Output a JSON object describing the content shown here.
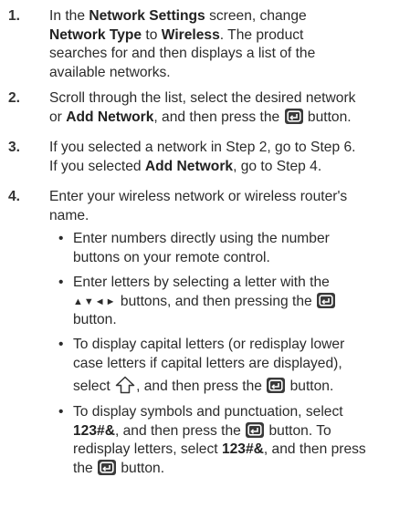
{
  "steps": [
    {
      "num": "1.",
      "parts": {
        "a": "In the ",
        "b": "Network Settings",
        "c": " screen, change",
        "d": "Network Type",
        "e": " to ",
        "f": "Wireless",
        "g": ". The product",
        "h": "searches for and then displays a list of the",
        "i": "available networks."
      }
    },
    {
      "num": "2.",
      "parts": {
        "a": "Scroll through the list, select the desired network",
        "b": "or ",
        "c": "Add Network",
        "d": ", and then press the",
        "e": "button."
      }
    },
    {
      "num": "3.",
      "parts": {
        "a": "If you selected a network in Step 2, go to Step 6.",
        "b": "If you selected ",
        "c": "Add Network",
        "d": ", go to Step 4."
      }
    },
    {
      "num": "4.",
      "parts": {
        "a": "Enter your wireless network or wireless router's",
        "b": "name."
      }
    }
  ],
  "bullets": [
    {
      "dot": "•",
      "l1": "Enter numbers directly using the number",
      "l2": "buttons on your remote control."
    },
    {
      "dot": "•",
      "l1": "Enter letters by selecting a letter with the",
      "l2_arrows": "▲▼◄►",
      "l2_rest": " buttons, and then pressing the",
      "l3": "button."
    },
    {
      "dot": "•",
      "l1": "To display capital letters (or redisplay lower",
      "l2": "case letters if capital letters are displayed),",
      "l3_a": "select",
      "l3_b": ", and then press the",
      "l3_c": "button."
    },
    {
      "dot": "•",
      "l1": "To display symbols and punctuation, select",
      "l2_bold": "123#&",
      "l2_rest": ", and then press the",
      "l2_end": "button. To",
      "l3_a": "redisplay letters, select ",
      "l3_bold": "123#&",
      "l3_rest": ", and then press",
      "l4_a": "the",
      "l4_b": "button."
    }
  ],
  "icons": {
    "enter_button": "enter-button-icon",
    "shift_arrow": "shift-arrow-icon"
  },
  "colors": {
    "text": "#2b2b2b",
    "icon_bg": "#3a3a3a"
  }
}
